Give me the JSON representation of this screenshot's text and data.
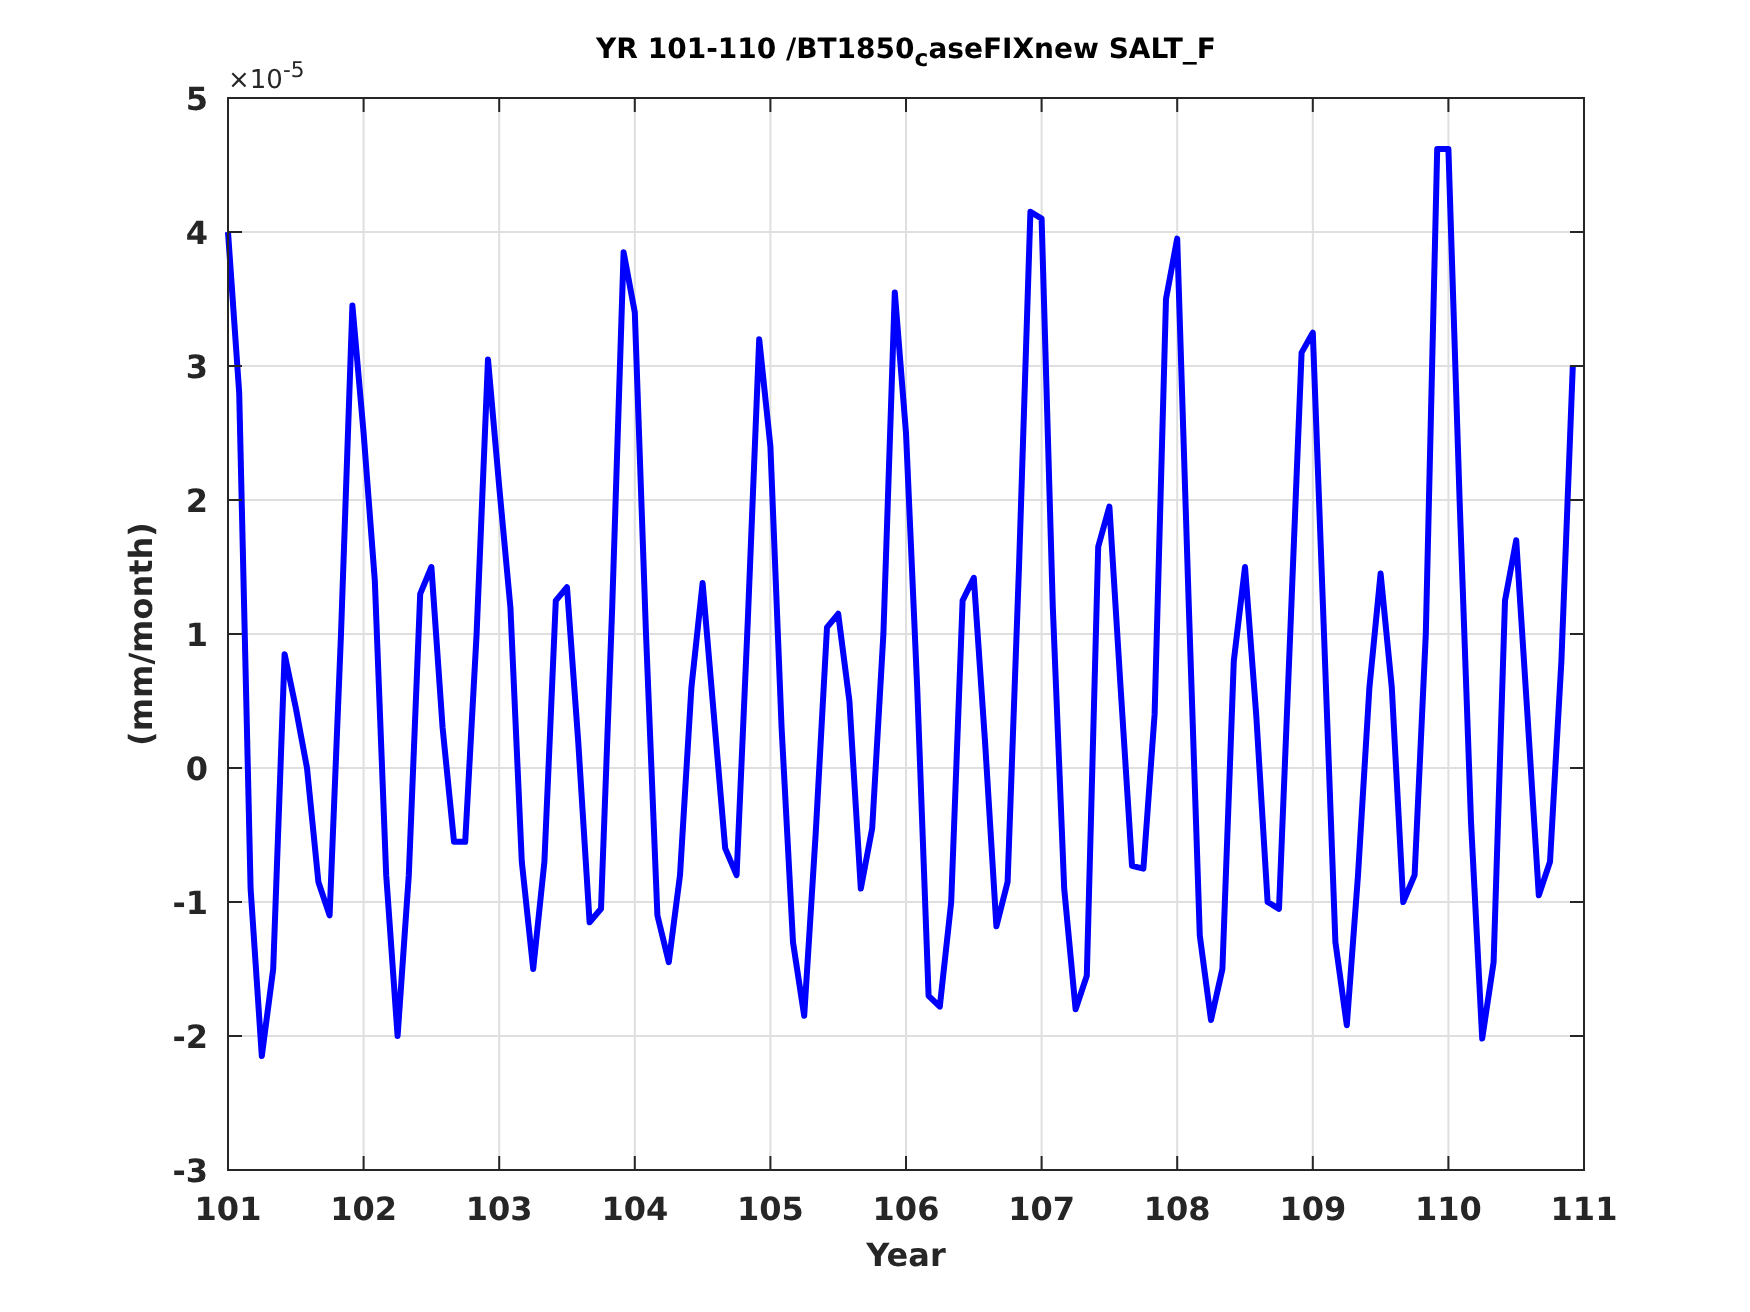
{
  "y_axis_multiplier": "×10$^{-5}$",
  "chart_data": {
    "type": "line",
    "title": "YR 101-110 /BT1850$_{c}$aseFIXnew SALT_F",
    "xlabel": "Year",
    "ylabel": "(mm/month)",
    "grid": true,
    "xlim": [
      101,
      111
    ],
    "ylim": [
      -3,
      5
    ],
    "xticks": [
      101,
      102,
      103,
      104,
      105,
      106,
      107,
      108,
      109,
      110,
      111
    ],
    "yticks": [
      -3,
      -2,
      -1,
      0,
      1,
      2,
      3,
      4,
      5
    ],
    "x": [
      101,
      101.083,
      101.167,
      101.25,
      101.333,
      101.417,
      101.5,
      101.583,
      101.667,
      101.75,
      101.833,
      101.917,
      102,
      102.083,
      102.167,
      102.25,
      102.333,
      102.417,
      102.5,
      102.583,
      102.667,
      102.75,
      102.833,
      102.917,
      103,
      103.083,
      103.167,
      103.25,
      103.333,
      103.417,
      103.5,
      103.583,
      103.667,
      103.75,
      103.833,
      103.917,
      104,
      104.083,
      104.167,
      104.25,
      104.333,
      104.417,
      104.5,
      104.583,
      104.667,
      104.75,
      104.833,
      104.917,
      105,
      105.083,
      105.167,
      105.25,
      105.333,
      105.417,
      105.5,
      105.583,
      105.667,
      105.75,
      105.833,
      105.917,
      106,
      106.083,
      106.167,
      106.25,
      106.333,
      106.417,
      106.5,
      106.583,
      106.667,
      106.75,
      106.833,
      106.917,
      107,
      107.083,
      107.167,
      107.25,
      107.333,
      107.417,
      107.5,
      107.583,
      107.667,
      107.75,
      107.833,
      107.917,
      108,
      108.083,
      108.167,
      108.25,
      108.333,
      108.417,
      108.5,
      108.583,
      108.667,
      108.75,
      108.833,
      108.917,
      109,
      109.083,
      109.167,
      109.25,
      109.333,
      109.417,
      109.5,
      109.583,
      109.667,
      109.75,
      109.833,
      109.917,
      110,
      110.083,
      110.167,
      110.25,
      110.333,
      110.417,
      110.5,
      110.583,
      110.667,
      110.75,
      110.833,
      110.917
    ],
    "series": [
      {
        "color": "#0000ff",
        "values": [
          4.0,
          2.8,
          -0.9,
          -2.15,
          -1.5,
          0.85,
          0.45,
          0.0,
          -0.85,
          -1.1,
          1.0,
          3.45,
          2.5,
          1.4,
          -0.8,
          -2.0,
          -0.8,
          1.3,
          1.5,
          0.3,
          -0.55,
          -0.55,
          1.0,
          3.05,
          2.1,
          1.2,
          -0.7,
          -1.5,
          -0.7,
          1.25,
          1.35,
          0.2,
          -1.15,
          -1.05,
          1.2,
          3.85,
          3.4,
          1.0,
          -1.1,
          -1.45,
          -0.8,
          0.6,
          1.38,
          0.4,
          -0.6,
          -0.8,
          1.1,
          3.2,
          2.4,
          0.3,
          -1.3,
          -1.85,
          -0.5,
          1.05,
          1.15,
          0.5,
          -0.9,
          -0.45,
          1.0,
          3.55,
          2.5,
          0.6,
          -1.7,
          -1.78,
          -1.0,
          1.25,
          1.42,
          0.2,
          -1.18,
          -0.85,
          1.5,
          4.15,
          4.1,
          1.2,
          -0.9,
          -1.8,
          -1.55,
          1.65,
          1.95,
          0.6,
          -0.73,
          -0.75,
          0.4,
          3.5,
          3.95,
          1.3,
          -1.25,
          -1.88,
          -1.5,
          0.8,
          1.5,
          0.4,
          -1.0,
          -1.05,
          1.0,
          3.1,
          3.25,
          1.0,
          -1.3,
          -1.92,
          -0.8,
          0.6,
          1.45,
          0.6,
          -1.0,
          -0.8,
          1.0,
          4.62,
          4.62,
          2.0,
          -0.4,
          -2.02,
          -1.45,
          1.25,
          1.7,
          0.4,
          -0.95,
          -0.7,
          0.8,
          3.0
        ]
      }
    ]
  }
}
